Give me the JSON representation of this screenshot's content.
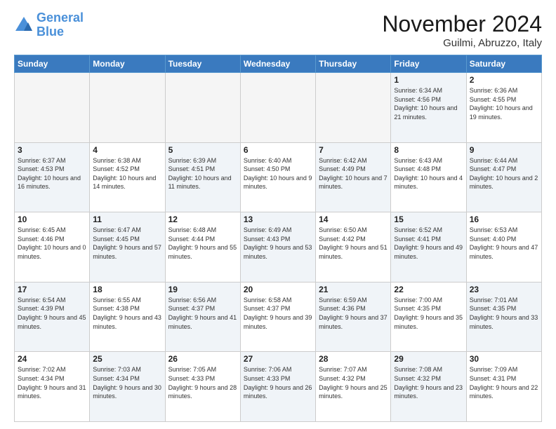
{
  "header": {
    "logo_general": "General",
    "logo_blue": "Blue",
    "month_title": "November 2024",
    "location": "Guilmi, Abruzzo, Italy"
  },
  "days_of_week": [
    "Sunday",
    "Monday",
    "Tuesday",
    "Wednesday",
    "Thursday",
    "Friday",
    "Saturday"
  ],
  "weeks": [
    [
      {
        "day": "",
        "info": "",
        "empty": true
      },
      {
        "day": "",
        "info": "",
        "empty": true
      },
      {
        "day": "",
        "info": "",
        "empty": true
      },
      {
        "day": "",
        "info": "",
        "empty": true
      },
      {
        "day": "",
        "info": "",
        "empty": true
      },
      {
        "day": "1",
        "info": "Sunrise: 6:34 AM\nSunset: 4:56 PM\nDaylight: 10 hours and 21 minutes.",
        "shaded": true
      },
      {
        "day": "2",
        "info": "Sunrise: 6:36 AM\nSunset: 4:55 PM\nDaylight: 10 hours and 19 minutes.",
        "shaded": false
      }
    ],
    [
      {
        "day": "3",
        "info": "Sunrise: 6:37 AM\nSunset: 4:53 PM\nDaylight: 10 hours and 16 minutes.",
        "shaded": true
      },
      {
        "day": "4",
        "info": "Sunrise: 6:38 AM\nSunset: 4:52 PM\nDaylight: 10 hours and 14 minutes.",
        "shaded": false
      },
      {
        "day": "5",
        "info": "Sunrise: 6:39 AM\nSunset: 4:51 PM\nDaylight: 10 hours and 11 minutes.",
        "shaded": true
      },
      {
        "day": "6",
        "info": "Sunrise: 6:40 AM\nSunset: 4:50 PM\nDaylight: 10 hours and 9 minutes.",
        "shaded": false
      },
      {
        "day": "7",
        "info": "Sunrise: 6:42 AM\nSunset: 4:49 PM\nDaylight: 10 hours and 7 minutes.",
        "shaded": true
      },
      {
        "day": "8",
        "info": "Sunrise: 6:43 AM\nSunset: 4:48 PM\nDaylight: 10 hours and 4 minutes.",
        "shaded": false
      },
      {
        "day": "9",
        "info": "Sunrise: 6:44 AM\nSunset: 4:47 PM\nDaylight: 10 hours and 2 minutes.",
        "shaded": true
      }
    ],
    [
      {
        "day": "10",
        "info": "Sunrise: 6:45 AM\nSunset: 4:46 PM\nDaylight: 10 hours and 0 minutes.",
        "shaded": false
      },
      {
        "day": "11",
        "info": "Sunrise: 6:47 AM\nSunset: 4:45 PM\nDaylight: 9 hours and 57 minutes.",
        "shaded": true
      },
      {
        "day": "12",
        "info": "Sunrise: 6:48 AM\nSunset: 4:44 PM\nDaylight: 9 hours and 55 minutes.",
        "shaded": false
      },
      {
        "day": "13",
        "info": "Sunrise: 6:49 AM\nSunset: 4:43 PM\nDaylight: 9 hours and 53 minutes.",
        "shaded": true
      },
      {
        "day": "14",
        "info": "Sunrise: 6:50 AM\nSunset: 4:42 PM\nDaylight: 9 hours and 51 minutes.",
        "shaded": false
      },
      {
        "day": "15",
        "info": "Sunrise: 6:52 AM\nSunset: 4:41 PM\nDaylight: 9 hours and 49 minutes.",
        "shaded": true
      },
      {
        "day": "16",
        "info": "Sunrise: 6:53 AM\nSunset: 4:40 PM\nDaylight: 9 hours and 47 minutes.",
        "shaded": false
      }
    ],
    [
      {
        "day": "17",
        "info": "Sunrise: 6:54 AM\nSunset: 4:39 PM\nDaylight: 9 hours and 45 minutes.",
        "shaded": true
      },
      {
        "day": "18",
        "info": "Sunrise: 6:55 AM\nSunset: 4:38 PM\nDaylight: 9 hours and 43 minutes.",
        "shaded": false
      },
      {
        "day": "19",
        "info": "Sunrise: 6:56 AM\nSunset: 4:37 PM\nDaylight: 9 hours and 41 minutes.",
        "shaded": true
      },
      {
        "day": "20",
        "info": "Sunrise: 6:58 AM\nSunset: 4:37 PM\nDaylight: 9 hours and 39 minutes.",
        "shaded": false
      },
      {
        "day": "21",
        "info": "Sunrise: 6:59 AM\nSunset: 4:36 PM\nDaylight: 9 hours and 37 minutes.",
        "shaded": true
      },
      {
        "day": "22",
        "info": "Sunrise: 7:00 AM\nSunset: 4:35 PM\nDaylight: 9 hours and 35 minutes.",
        "shaded": false
      },
      {
        "day": "23",
        "info": "Sunrise: 7:01 AM\nSunset: 4:35 PM\nDaylight: 9 hours and 33 minutes.",
        "shaded": true
      }
    ],
    [
      {
        "day": "24",
        "info": "Sunrise: 7:02 AM\nSunset: 4:34 PM\nDaylight: 9 hours and 31 minutes.",
        "shaded": false
      },
      {
        "day": "25",
        "info": "Sunrise: 7:03 AM\nSunset: 4:34 PM\nDaylight: 9 hours and 30 minutes.",
        "shaded": true
      },
      {
        "day": "26",
        "info": "Sunrise: 7:05 AM\nSunset: 4:33 PM\nDaylight: 9 hours and 28 minutes.",
        "shaded": false
      },
      {
        "day": "27",
        "info": "Sunrise: 7:06 AM\nSunset: 4:33 PM\nDaylight: 9 hours and 26 minutes.",
        "shaded": true
      },
      {
        "day": "28",
        "info": "Sunrise: 7:07 AM\nSunset: 4:32 PM\nDaylight: 9 hours and 25 minutes.",
        "shaded": false
      },
      {
        "day": "29",
        "info": "Sunrise: 7:08 AM\nSunset: 4:32 PM\nDaylight: 9 hours and 23 minutes.",
        "shaded": true
      },
      {
        "day": "30",
        "info": "Sunrise: 7:09 AM\nSunset: 4:31 PM\nDaylight: 9 hours and 22 minutes.",
        "shaded": false
      }
    ]
  ]
}
